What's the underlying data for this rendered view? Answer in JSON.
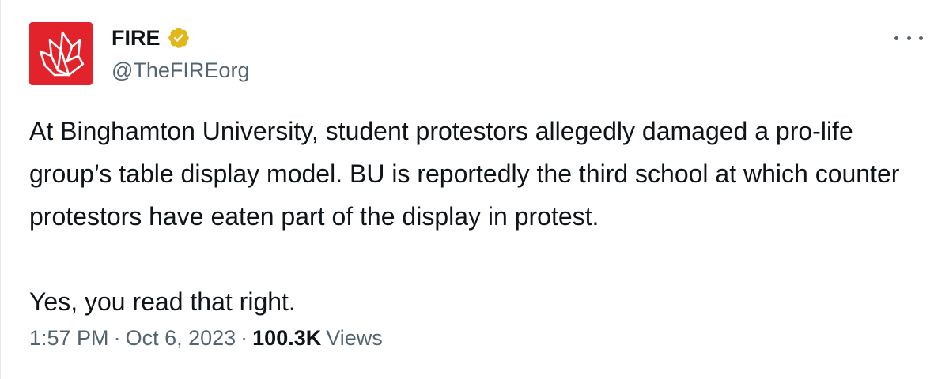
{
  "colors": {
    "brand_red": "#e3232b",
    "verified_gold": "#e2b719",
    "text_primary": "#0f1419",
    "text_secondary": "#536471"
  },
  "author": {
    "display_name": "FIRE",
    "handle": "@TheFIREorg",
    "verified_icon": "verified-gold-badge-icon",
    "avatar_icon": "fire-logo-icon"
  },
  "menu": {
    "icon": "more-horizontal-icon"
  },
  "tweet": {
    "paragraphs": [
      "At Binghamton University, student protestors allegedly damaged a pro-life group’s table display model. BU is reportedly the third school at which counter protestors have eaten part of the display in protest.",
      "Yes, you read that right."
    ]
  },
  "meta": {
    "time": "1:57 PM",
    "separator": "·",
    "date": "Oct 6, 2023",
    "views_count": "100.3K",
    "views_label": "Views"
  }
}
